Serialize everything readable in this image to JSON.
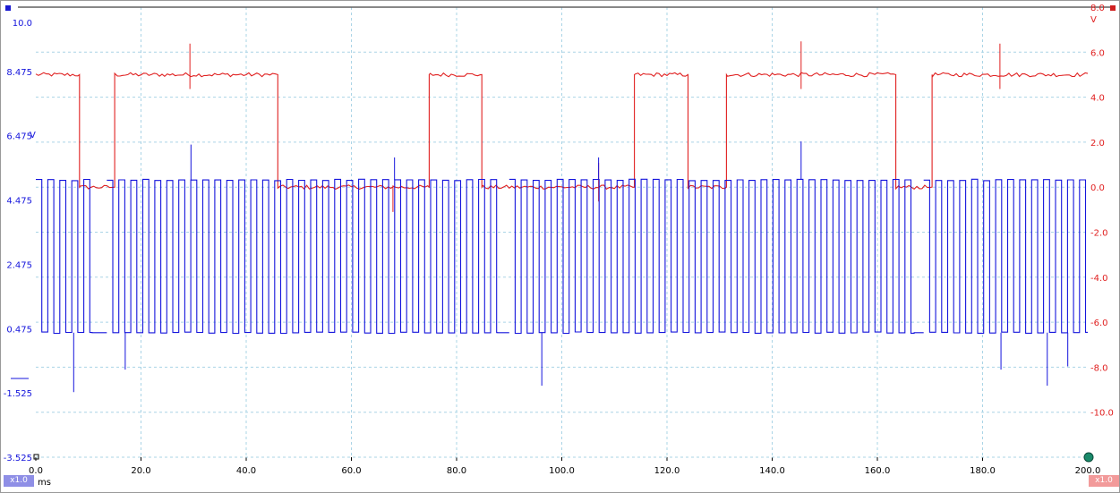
{
  "chart_data": {
    "type": "line",
    "x_unit": "ms",
    "x_ticks": [
      "0.0",
      "20.0",
      "40.0",
      "60.0",
      "80.0",
      "100.0",
      "120.0",
      "140.0",
      "160.0",
      "180.0",
      "200.0"
    ],
    "xlim": [
      0,
      200
    ],
    "grid": true,
    "left_axis": {
      "unit": "V",
      "color": "#1414dc",
      "ticks": [
        "10.0",
        "8.475",
        "6.475",
        "4.475",
        "2.475",
        "0.475",
        "-1.525",
        "-3.525"
      ],
      "range": [
        -3.525,
        10.475
      ]
    },
    "right_axis": {
      "unit": "V",
      "color": "#e02020",
      "ticks": [
        "8.0",
        "6.0",
        "4.0",
        "2.0",
        "0.0",
        "-2.0",
        "-4.0",
        "-6.0",
        "-8.0",
        "-10.0"
      ],
      "range": [
        -12.0,
        8.0
      ]
    },
    "series": [
      {
        "axis": "right",
        "color": "#e02020",
        "high": 5.0,
        "low": 0.0,
        "edges_ms": [
          8.3,
          15.0,
          46.0,
          74.8,
          84.8,
          113.8,
          124.0,
          131.3,
          163.5,
          170.4
        ],
        "spikes": [
          {
            "x": 29.3,
            "y": 6.3
          },
          {
            "x": 67.9,
            "y": -1.1
          },
          {
            "x": 107.0,
            "y": 1.0
          },
          {
            "x": 145.5,
            "y": 6.4
          },
          {
            "x": 183.3,
            "y": 6.3
          }
        ]
      },
      {
        "axis": "left",
        "color": "#1414dc",
        "high": 5.1,
        "low": 0.35,
        "active_ms": [
          [
            0.0,
            10.7
          ],
          [
            13.5,
            87.8
          ],
          [
            90.0,
            167.0
          ],
          [
            168.8,
            200.0
          ]
        ],
        "period_ms": 2.28,
        "spikes": [
          {
            "x": 7.2,
            "y": -1.5
          },
          {
            "x": 17.0,
            "y": -0.8
          },
          {
            "x": 29.5,
            "y": 6.2
          },
          {
            "x": 68.2,
            "y": 5.8
          },
          {
            "x": 96.2,
            "y": -1.3
          },
          {
            "x": 107.0,
            "y": 5.8
          },
          {
            "x": 145.5,
            "y": 6.3
          },
          {
            "x": 183.5,
            "y": -0.8
          },
          {
            "x": 192.3,
            "y": -1.3
          },
          {
            "x": 196.2,
            "y": -0.7
          }
        ]
      }
    ]
  },
  "scale_left": "x1.0",
  "scale_right": "x1.0",
  "colors": {
    "grid": "#aad4e6",
    "frame": "#606060"
  }
}
